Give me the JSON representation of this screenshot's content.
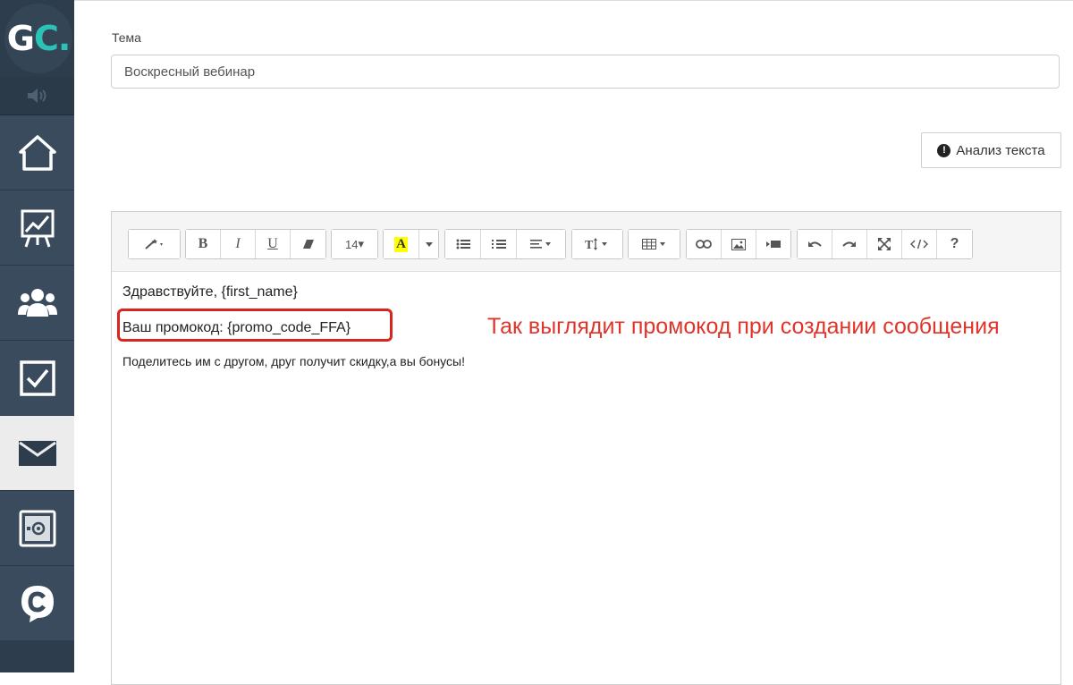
{
  "sidebar": {
    "logo": {
      "text_main": "G",
      "text_accent": "C."
    },
    "items": [
      {
        "name": "home-icon"
      },
      {
        "name": "chart-icon"
      },
      {
        "name": "users-icon"
      },
      {
        "name": "tasks-icon"
      },
      {
        "name": "mail-icon",
        "active": true
      },
      {
        "name": "safe-icon"
      },
      {
        "name": "chat-icon"
      }
    ],
    "colors": {
      "bg": "#2e3d4d",
      "item": "#3a4b5d",
      "active": "#ececec",
      "accent": "#2cc3b7"
    }
  },
  "subject": {
    "label": "Тема",
    "value": "Воскресный вебинар"
  },
  "analyze_button": {
    "label": "Анализ текста"
  },
  "toolbar": {
    "font_size": "14",
    "font_size_caret": "▾",
    "bold": "B",
    "italic": "I",
    "underline": "U",
    "highlight_letter": "A",
    "help": "?"
  },
  "editor": {
    "greeting": "Здравствуйте, {first_name}",
    "promo_line": "Ваш промокод: {promo_code_FFA}",
    "share_line": "Поделитесь им с другом, друг получит скидку,а  вы бонусы!"
  },
  "annotation": {
    "text": "Так выглядит промокод при создании сообщения",
    "color": "#e0342a"
  }
}
